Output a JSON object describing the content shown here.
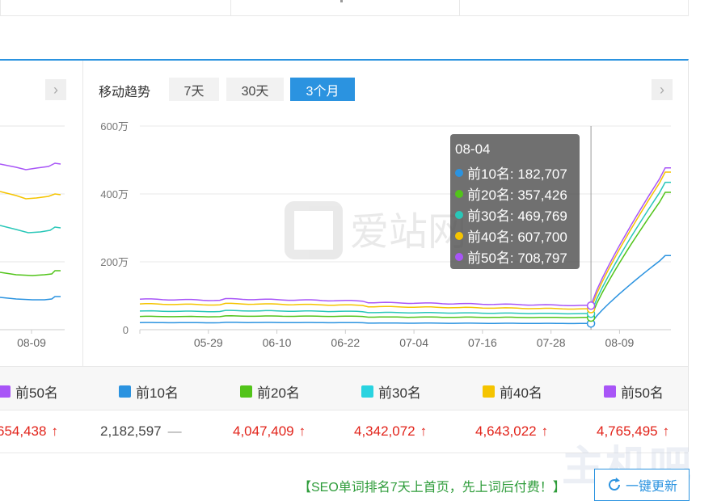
{
  "top_table": {
    "cells": [
      "",
      "",
      ""
    ]
  },
  "left_panel": {
    "next_label": "›",
    "x_tick": "08-09",
    "legend_label": "前50名",
    "value": "654,438",
    "value_arrow": "↑"
  },
  "trend": {
    "label": "移动趋势",
    "ranges": [
      "7天",
      "30天",
      "3个月"
    ],
    "active_range": "3个月",
    "next_label": "›"
  },
  "chart_data": {
    "type": "line",
    "x_ticks": [
      "05-29",
      "06-10",
      "06-22",
      "07-04",
      "07-16",
      "07-28",
      "08-09"
    ],
    "y_ticks": [
      "0",
      "200万",
      "400万",
      "600万"
    ],
    "ylim": [
      0,
      6000000
    ],
    "x_count": 94,
    "tick_indices": [
      12,
      24,
      36,
      48,
      60,
      72,
      84
    ],
    "hover_index": 79,
    "watermark": "爱站网",
    "tooltip": {
      "date": "08-04",
      "rows": [
        {
          "label": "前10名",
          "value": "182,707"
        },
        {
          "label": "前20名",
          "value": "357,426"
        },
        {
          "label": "前30名",
          "value": "469,769"
        },
        {
          "label": "前40名",
          "value": "607,700"
        },
        {
          "label": "前50名",
          "value": "708,797"
        }
      ]
    },
    "series": [
      {
        "name": "前10名",
        "color": "#2b93e0",
        "start": 210000,
        "end_base": 182707,
        "final": 2182597
      },
      {
        "name": "前20名",
        "color": "#52c41a",
        "start": 390000,
        "end_base": 357426,
        "final": 4047409
      },
      {
        "name": "前30名",
        "color": "#29c7b8",
        "start": 550000,
        "end_base": 469769,
        "final": 4342072
      },
      {
        "name": "前40名",
        "color": "#f5c400",
        "start": 760000,
        "end_base": 607700,
        "final": 4643022
      },
      {
        "name": "前50名",
        "color": "#a855f7",
        "start": 900000,
        "end_base": 708797,
        "final": 4765495
      }
    ]
  },
  "legend": [
    {
      "label": "前10名",
      "color": "#2b93e0"
    },
    {
      "label": "前20名",
      "color": "#52c41a"
    },
    {
      "label": "前30名",
      "color": "#29d3e0"
    },
    {
      "label": "前40名",
      "color": "#f5c400"
    },
    {
      "label": "前50名",
      "color": "#a855f7"
    }
  ],
  "values": [
    {
      "value": "2,182,597",
      "trend": "—",
      "type": "flat"
    },
    {
      "value": "4,047,409",
      "trend": "↑",
      "type": "up"
    },
    {
      "value": "4,342,072",
      "trend": "↑",
      "type": "up"
    },
    {
      "value": "4,643,022",
      "trend": "↑",
      "type": "up"
    },
    {
      "value": "4,765,495",
      "trend": "↑",
      "type": "up"
    }
  ],
  "promo": "【SEO单词排名7天上首页，先上词后付费！】",
  "update_button": "一键更新",
  "site_watermark": "主机吧"
}
